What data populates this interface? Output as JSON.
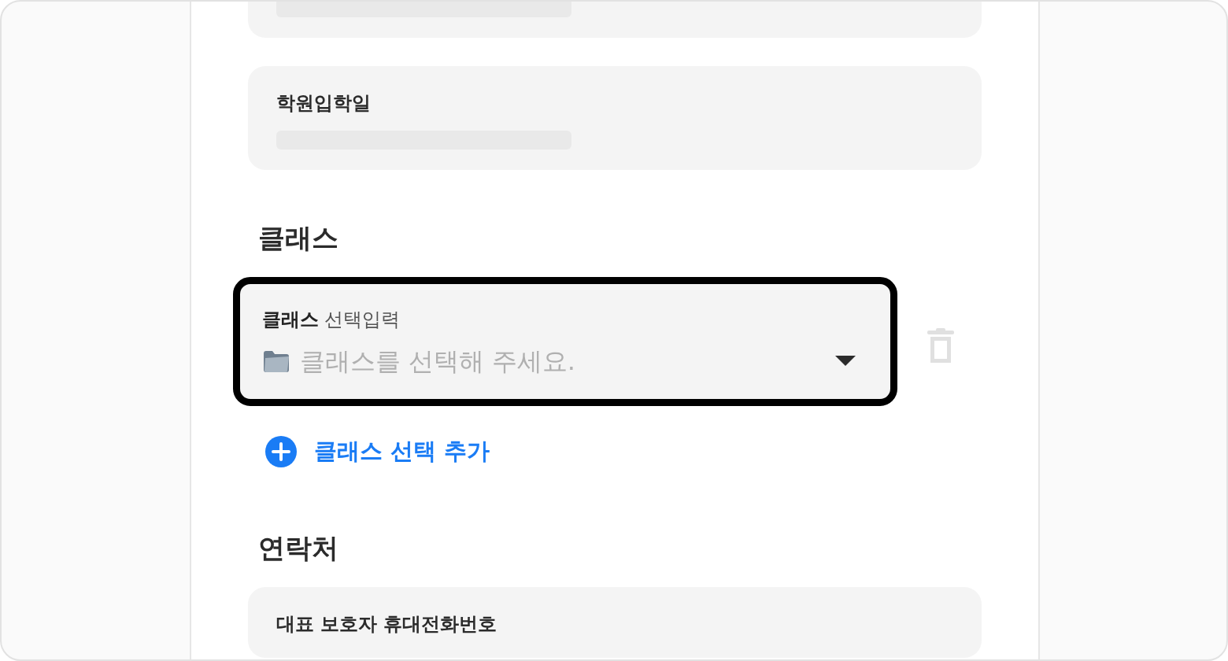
{
  "sections": [
    {
      "kind": "card",
      "loading": true
    },
    {
      "kind": "card",
      "label": "학원입학일",
      "loading": true
    },
    {
      "kind": "heading",
      "text": "클래스"
    },
    {
      "kind": "select",
      "label": "**클래스** 선택입력",
      "placeholder": "클래스를 선택해 주세요.",
      "focused": true
    },
    {
      "kind": "add",
      "text": "클래스 선택 추가"
    },
    {
      "kind": "heading",
      "text": "연락처"
    },
    {
      "kind": "card",
      "label": "대표 보호자 휴대전화번호",
      "loading": false
    }
  ]
}
